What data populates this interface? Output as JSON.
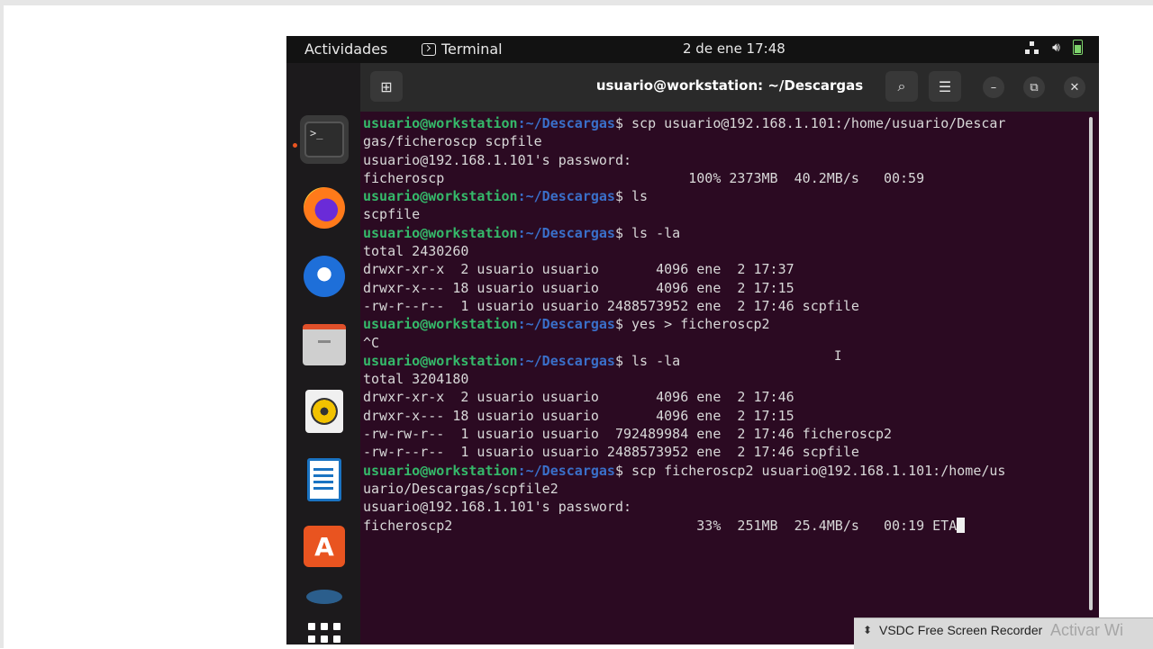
{
  "topbar": {
    "activities": "Actividades",
    "app_name": "Terminal",
    "clock": "2 de ene  17:48"
  },
  "window": {
    "title": "usuario@workstation: ~/Descargas"
  },
  "terminal": {
    "prompt_user": "usuario@workstation",
    "prompt_path": ":~/Descargas",
    "lines": [
      {
        "kind": "prompt",
        "text": "$ scp usuario@192.168.1.101:/home/usuario/Descar"
      },
      {
        "kind": "out",
        "text": "gas/ficheroscp scpfile"
      },
      {
        "kind": "out",
        "text": "usuario@192.168.1.101's password:"
      },
      {
        "kind": "out",
        "text": "ficheroscp                              100% 2373MB  40.2MB/s   00:59"
      },
      {
        "kind": "prompt",
        "text": "$ ls"
      },
      {
        "kind": "out",
        "text": "scpfile"
      },
      {
        "kind": "prompt",
        "text": "$ ls -la"
      },
      {
        "kind": "out",
        "text": "total 2430260"
      },
      {
        "kind": "out",
        "text": "drwxr-xr-x  2 usuario usuario       4096 ene  2 17:37"
      },
      {
        "kind": "out",
        "text": "drwxr-x--- 18 usuario usuario       4096 ene  2 17:15"
      },
      {
        "kind": "out",
        "text": "-rw-r--r--  1 usuario usuario 2488573952 ene  2 17:46 scpfile"
      },
      {
        "kind": "prompt",
        "text": "$ yes > ficheroscp2"
      },
      {
        "kind": "out",
        "text": "^C"
      },
      {
        "kind": "prompt",
        "text": "$ ls -la"
      },
      {
        "kind": "out",
        "text": "total 3204180"
      },
      {
        "kind": "out",
        "text": "drwxr-xr-x  2 usuario usuario       4096 ene  2 17:46"
      },
      {
        "kind": "out",
        "text": "drwxr-x--- 18 usuario usuario       4096 ene  2 17:15"
      },
      {
        "kind": "out",
        "text": "-rw-rw-r--  1 usuario usuario  792489984 ene  2 17:46 ficheroscp2"
      },
      {
        "kind": "out",
        "text": "-rw-r--r--  1 usuario usuario 2488573952 ene  2 17:46 scpfile"
      },
      {
        "kind": "prompt",
        "text": "$ scp ficheroscp2 usuario@192.168.1.101:/home/us"
      },
      {
        "kind": "out",
        "text": "uario/Descargas/scpfile2"
      },
      {
        "kind": "out",
        "text": "usuario@192.168.1.101's password:"
      },
      {
        "kind": "out",
        "text": "ficheroscp2                              33%  251MB  25.4MB/s   00:19 ETA",
        "cursor": true
      }
    ]
  },
  "recorder": {
    "label": "VSDC Free Screen Recorder",
    "watermark": "Activar Wi"
  },
  "icons": {
    "dock": [
      "terminal-icon",
      "firefox-icon",
      "thunderbird-icon",
      "files-icon",
      "rhythmbox-icon",
      "writer-icon",
      "software-icon",
      "disk-icon",
      "app-grid-icon"
    ]
  }
}
